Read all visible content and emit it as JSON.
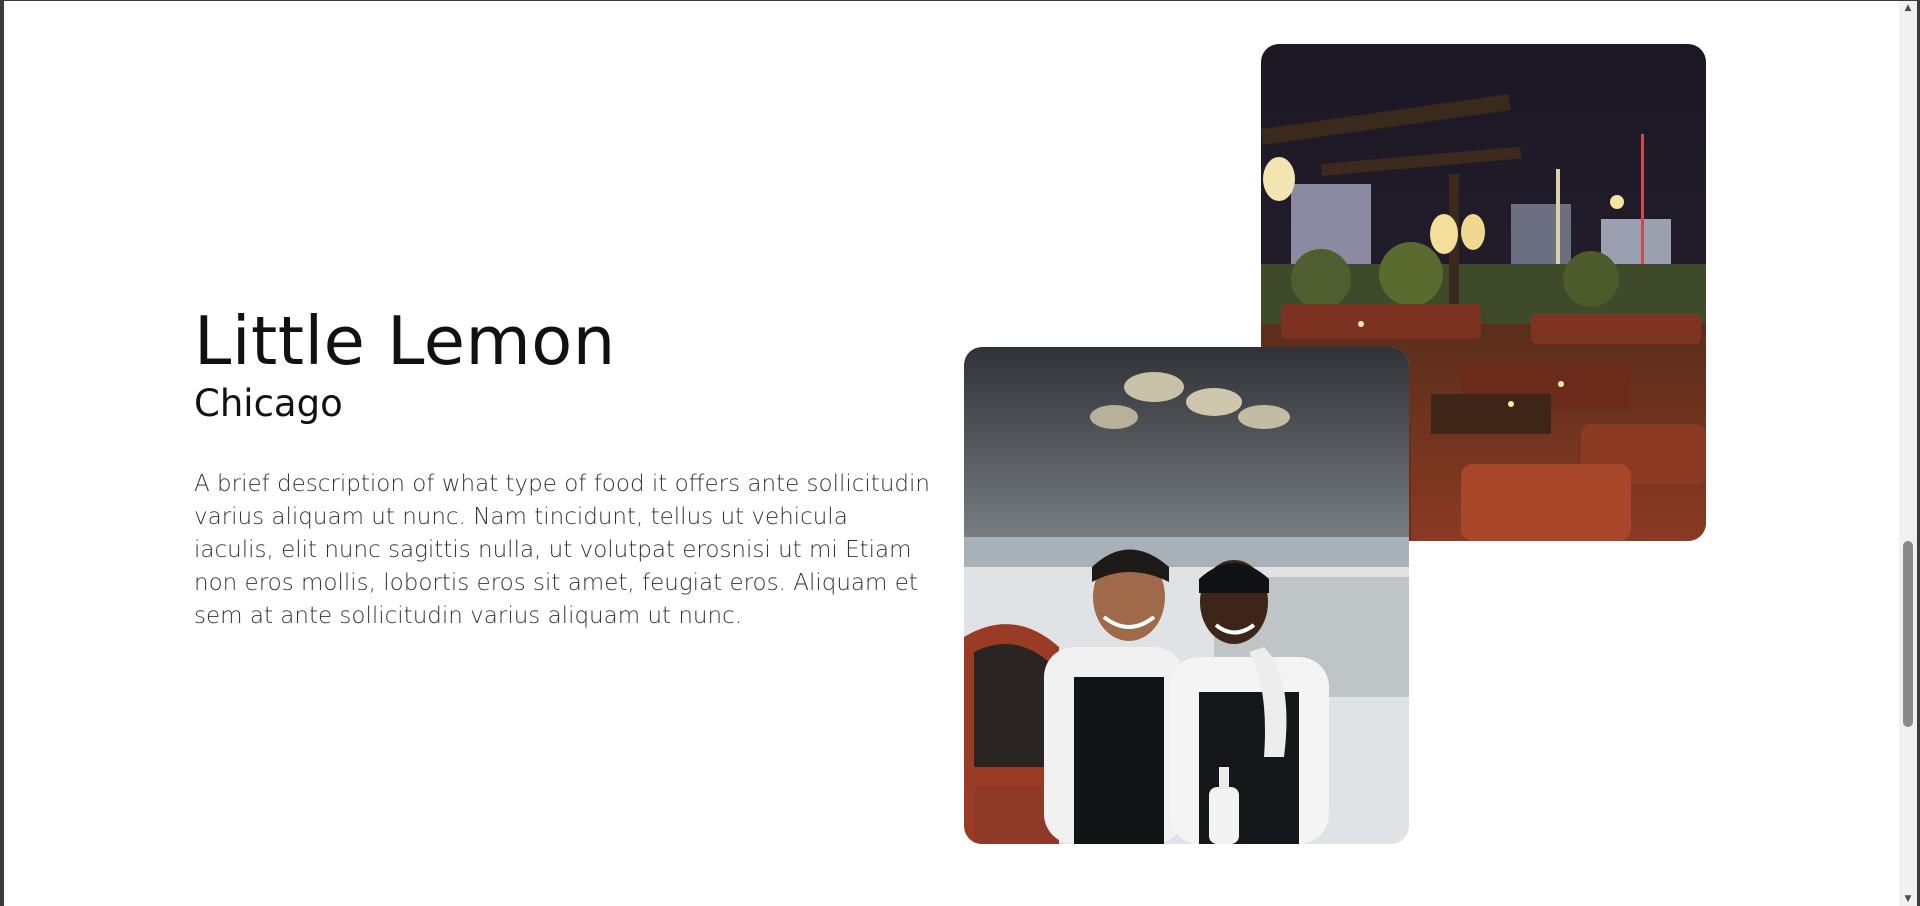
{
  "about": {
    "title": "Little Lemon",
    "subtitle": "Chicago",
    "description": "A brief description of what type of food it offers ante sollicitudin varius aliquam ut nunc. Nam tincidunt, tellus ut vehicula iaculis, elit nunc sagittis nulla, ut volutpat erosnisi ut mi Etiam non eros mollis, lobortis eros sit amet, feugiat eros. Aliquam et sem at ante sollicitudin varius aliquam ut nunc."
  },
  "colors": {
    "background": "#ffffff",
    "text": "#111111",
    "window_frame": "#3b3b3b"
  },
  "scrollbar": {
    "up_icon": "scroll-up-arrow",
    "down_icon": "scroll-down-arrow"
  }
}
